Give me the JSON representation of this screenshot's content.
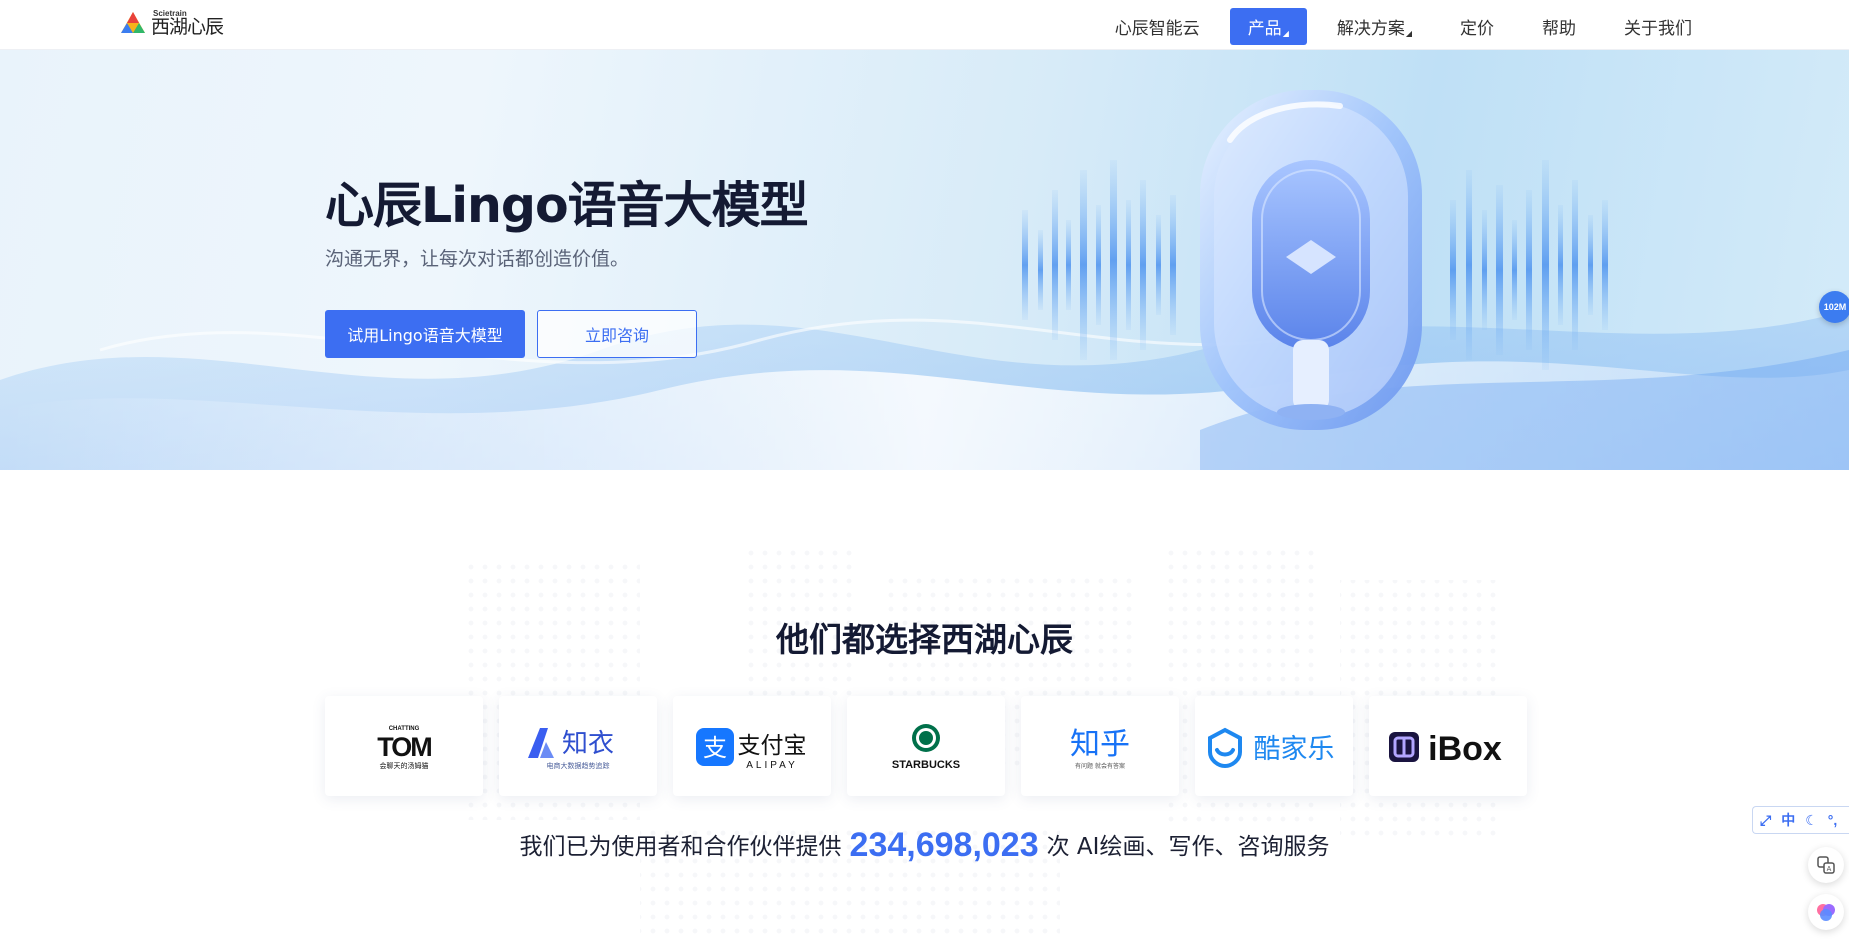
{
  "header": {
    "logo_en": "Scietrain",
    "logo_cn": "西湖心辰",
    "nav": [
      {
        "label": "心辰智能云",
        "active": false,
        "dropdown": false
      },
      {
        "label": "产品",
        "active": true,
        "dropdown": true
      },
      {
        "label": "解决方案",
        "active": false,
        "dropdown": true
      },
      {
        "label": "定价",
        "active": false,
        "dropdown": false
      },
      {
        "label": "帮助",
        "active": false,
        "dropdown": false
      },
      {
        "label": "关于我们",
        "active": false,
        "dropdown": false
      }
    ]
  },
  "hero": {
    "title": "心辰Lingo语音大模型",
    "subtitle": "沟通无界，让每次对话都创造价值。",
    "primary_button": "试用Lingo语音大模型",
    "secondary_button": "立即咨询"
  },
  "float_badge": "102M",
  "customers": {
    "title": "他们都选择西湖心辰",
    "logos": [
      {
        "name": "TOM",
        "top": "CHATTING",
        "sub": "会聊天的汤姆猫"
      },
      {
        "name": "知衣",
        "sub": "电商大数据趋势追踪"
      },
      {
        "name": "支付宝",
        "sub": "ALIPAY"
      },
      {
        "name": "STARBUCKS"
      },
      {
        "name": "知乎",
        "sub": "有问题 就会有答案"
      },
      {
        "name": "酷家乐"
      },
      {
        "name": "iBox"
      }
    ],
    "stat_prefix": "我们已为使用者和合作伙伴提供",
    "stat_number": "234,698,023",
    "stat_suffix": "次 AI绘画、写作、咨询服务"
  },
  "toolbar": {
    "lang": "中"
  },
  "colors": {
    "accent": "#3c6ef2",
    "title": "#141a33"
  }
}
